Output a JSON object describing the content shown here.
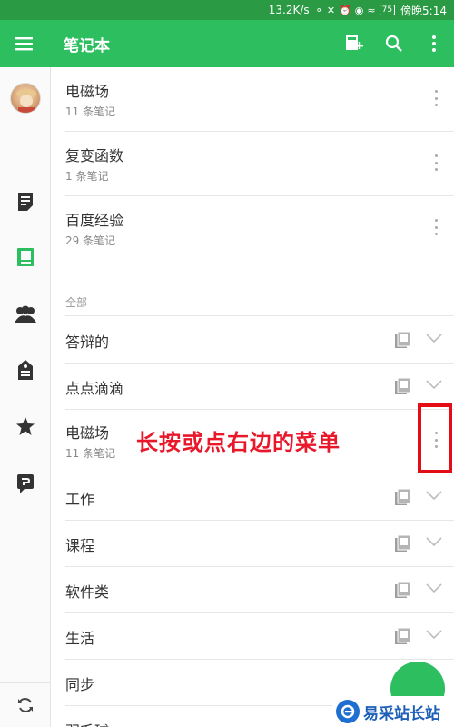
{
  "status_bar": {
    "speed": "13.2K/s",
    "battery": "75",
    "time": "傍晚5:14"
  },
  "app_bar": {
    "title": "笔记本",
    "icons": [
      "hamburger-menu-icon",
      "new-notebook-icon",
      "search-icon",
      "more-vert-icon"
    ]
  },
  "sidebar": {
    "items": [
      {
        "name": "avatar"
      },
      {
        "icon": "note-icon"
      },
      {
        "icon": "notebook-icon",
        "active": true
      },
      {
        "icon": "people-icon"
      },
      {
        "icon": "tag-icon"
      },
      {
        "icon": "star-icon"
      },
      {
        "icon": "work-chat-icon"
      },
      {
        "icon": "sync-icon"
      }
    ]
  },
  "recent_notebooks": [
    {
      "name": "电磁场",
      "count": "11 条笔记"
    },
    {
      "name": "复变函数",
      "count": "1 条笔记"
    },
    {
      "name": "百度经验",
      "count": "29 条笔记"
    }
  ],
  "all_section": {
    "label": "全部",
    "rows": [
      {
        "name": "答辩的",
        "type": "stack"
      },
      {
        "name": "点点滴滴",
        "type": "stack"
      },
      {
        "name": "电磁场",
        "count": "11 条笔记",
        "type": "notebook"
      },
      {
        "name": "工作",
        "type": "stack"
      },
      {
        "name": "课程",
        "type": "stack"
      },
      {
        "name": "软件类",
        "type": "stack"
      },
      {
        "name": "生活",
        "type": "stack"
      },
      {
        "name": "同步",
        "type": "stack"
      },
      {
        "name": "羽毛球",
        "type": "stack"
      }
    ]
  },
  "annotation": {
    "text": "长按或点右边的菜单",
    "color": "#e8172a"
  },
  "watermark": {
    "text": "易采站长站"
  },
  "colors": {
    "brand": "#2dbe60",
    "status_bar": "#2a9a44",
    "annotation_red": "#e30d16"
  }
}
